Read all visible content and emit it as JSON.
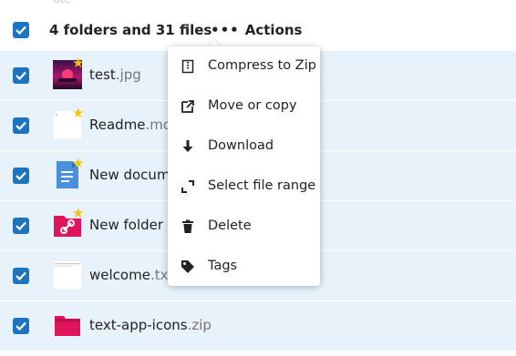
{
  "header": {
    "summary": "4 folders and 31 files",
    "actions_label": "Actions",
    "selected": true
  },
  "top_partial_text": "ute",
  "files": [
    {
      "name": "test",
      "ext": ".jpg",
      "favorite": true,
      "icon": "image-thumbnail"
    },
    {
      "name": "Readme",
      "ext": ".md",
      "favorite": true,
      "icon": "text-file-icon"
    },
    {
      "name": "New docume",
      "ext": "",
      "favorite": true,
      "icon": "document-icon"
    },
    {
      "name": "New folder (",
      "ext": "",
      "favorite": true,
      "icon": "shared-folder-link-icon"
    },
    {
      "name": "welcome",
      "ext": ".txt",
      "favorite": false,
      "icon": "text-file-icon"
    },
    {
      "name": "text-app-icons",
      "ext": ".zip",
      "favorite": false,
      "icon": "pink-folder-icon"
    }
  ],
  "menu": {
    "items": [
      {
        "label": "Compress to Zip",
        "icon": "zip-icon"
      },
      {
        "label": "Move or copy",
        "icon": "move-icon"
      },
      {
        "label": "Download",
        "icon": "download-icon"
      },
      {
        "label": "Select file range",
        "icon": "select-range-icon"
      },
      {
        "label": "Delete",
        "icon": "trash-icon"
      },
      {
        "label": "Tags",
        "icon": "tag-icon"
      }
    ]
  },
  "colors": {
    "accent": "#1e73be",
    "row_selected_bg": "#e7f2fb",
    "star": "#f5c400",
    "folder_pink": "#e0145c"
  }
}
